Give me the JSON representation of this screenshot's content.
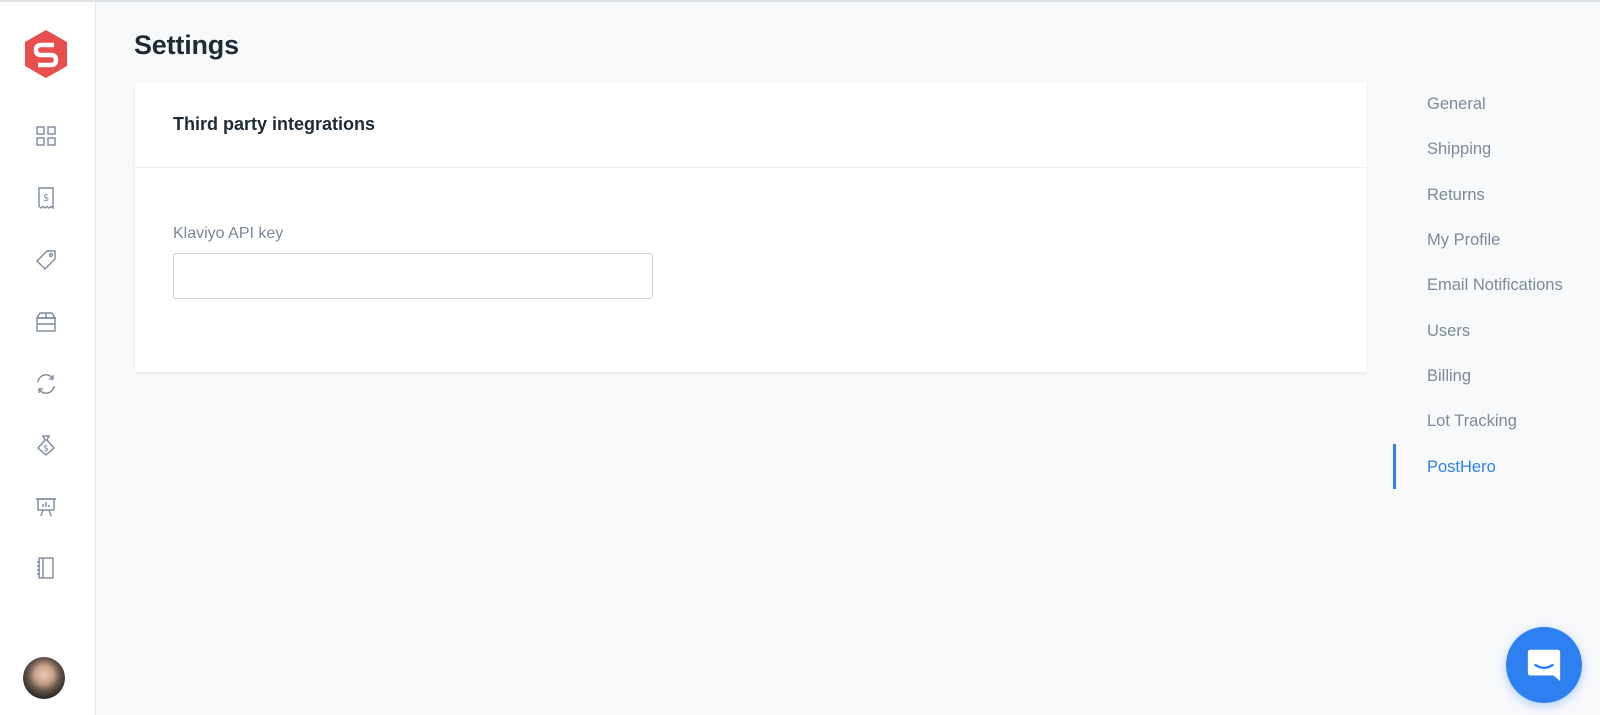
{
  "app": {
    "logo_name": "brand-logo",
    "brand_color": "#e94e4e",
    "accent_color": "#2e7ff0"
  },
  "sidebar": {
    "icons": [
      "dashboard-icon",
      "receipt-dollar-icon",
      "tag-icon",
      "box-icon",
      "refresh-icon",
      "money-bag-icon",
      "presentation-icon",
      "notebook-icon"
    ]
  },
  "page": {
    "title": "Settings"
  },
  "card": {
    "title": "Third party integrations",
    "field_label": "Klaviyo API key",
    "field_value": ""
  },
  "settings_menu": {
    "items": [
      {
        "label": "General"
      },
      {
        "label": "Shipping"
      },
      {
        "label": "Returns"
      },
      {
        "label": "My Profile"
      },
      {
        "label": "Email Notifications"
      },
      {
        "label": "Users"
      },
      {
        "label": "Billing"
      },
      {
        "label": "Lot Tracking"
      },
      {
        "label": "PostHero"
      }
    ],
    "active": "PostHero"
  },
  "chat": {
    "icon": "chat-bubble-icon"
  }
}
